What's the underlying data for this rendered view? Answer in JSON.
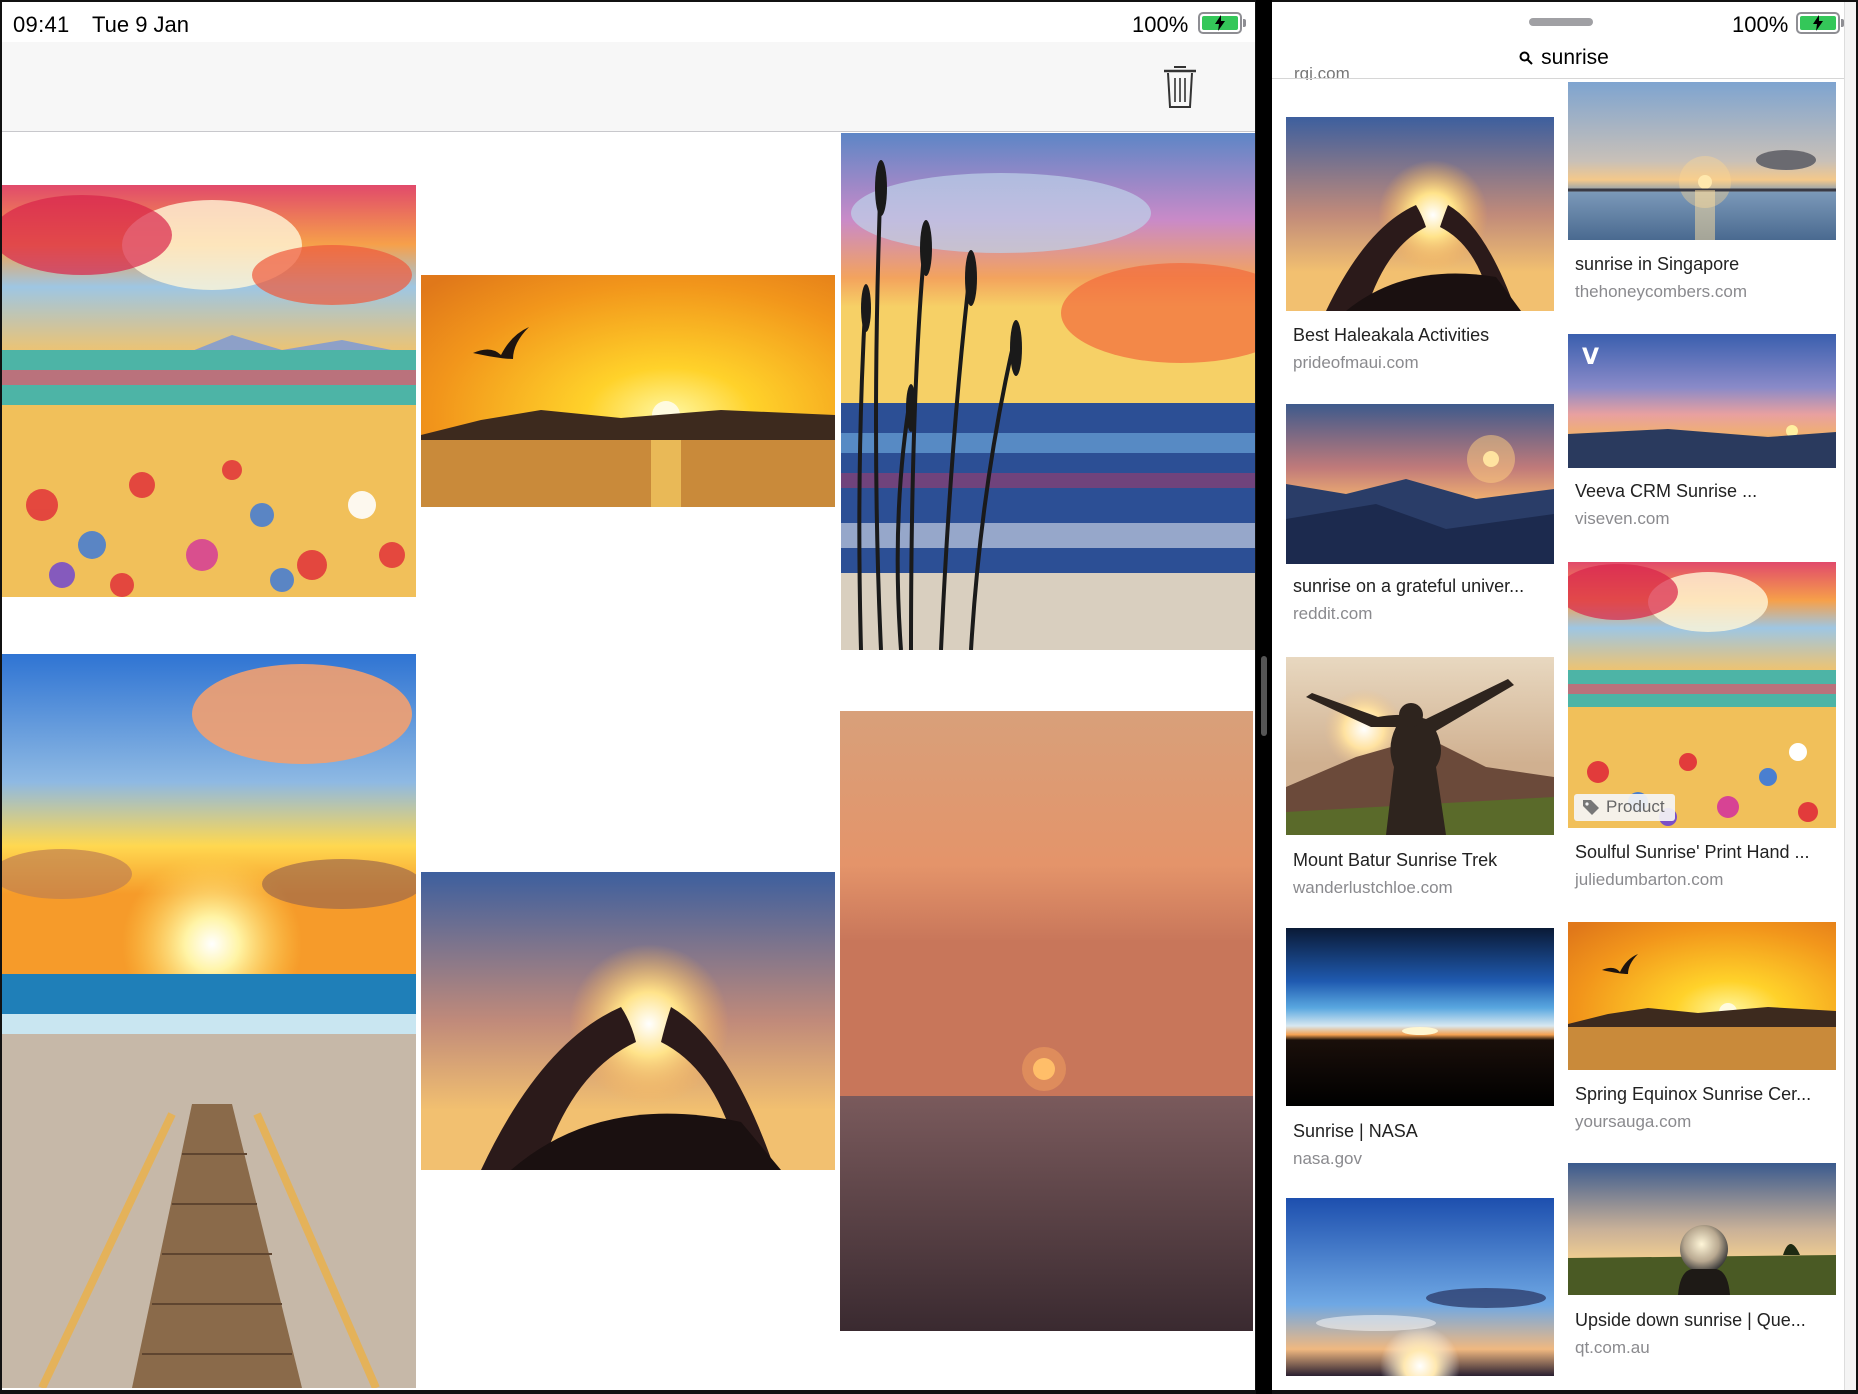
{
  "status_left": {
    "time": "09:41",
    "date": "Tue 9 Jan",
    "battery": "100%"
  },
  "status_right": {
    "battery": "100%"
  },
  "left_app": {
    "toolbar": {
      "trash_icon": "trash-icon"
    },
    "gallery": [
      {
        "name": "painted-field-sunrise",
        "scene": "field"
      },
      {
        "name": "bird-over-sea-sunset",
        "scene": "bird"
      },
      {
        "name": "painted-reeds-seascape",
        "scene": "reeds"
      },
      {
        "name": "beach-boardwalk-sunrise",
        "scene": "beach"
      },
      {
        "name": "heart-hands-sunrise",
        "scene": "heart"
      },
      {
        "name": "hazy-sea-sunset",
        "scene": "haze"
      }
    ]
  },
  "right_app": {
    "search": {
      "query": "sunrise",
      "icon": "search-icon"
    },
    "cutoff_source": "rgj.com",
    "results": [
      {
        "title": "Best Haleakala Activities",
        "source": "prideofmaui.com",
        "scene": "heart"
      },
      {
        "title": "sunrise in Singapore",
        "source": "thehoneycombers.com",
        "scene": "singapore"
      },
      {
        "title": "sunrise on a grateful univer...",
        "source": "reddit.com",
        "scene": "mountain"
      },
      {
        "title": "Veeva CRM Sunrise ...",
        "source": "viseven.com",
        "scene": "veeva"
      },
      {
        "title": "Mount Batur Sunrise Trek",
        "source": "wanderlustchloe.com",
        "scene": "woman"
      },
      {
        "title": "Soulful Sunrise' Print Hand ...",
        "source": "juliedumbarton.com",
        "scene": "field",
        "badge": "Product"
      },
      {
        "title": "Sunrise | NASA",
        "source": "nasa.gov",
        "scene": "nasa"
      },
      {
        "title": "Spring Equinox Sunrise Cer...",
        "source": "yoursauga.com",
        "scene": "bird"
      },
      {
        "title": "",
        "source": "",
        "scene": "sky"
      },
      {
        "title": "Upside down sunrise | Que...",
        "source": "qt.com.au",
        "scene": "ball"
      }
    ]
  },
  "colors": {
    "battery_green": "#34c759",
    "status_text": "#000000",
    "source_gray": "#8a8a8e"
  }
}
